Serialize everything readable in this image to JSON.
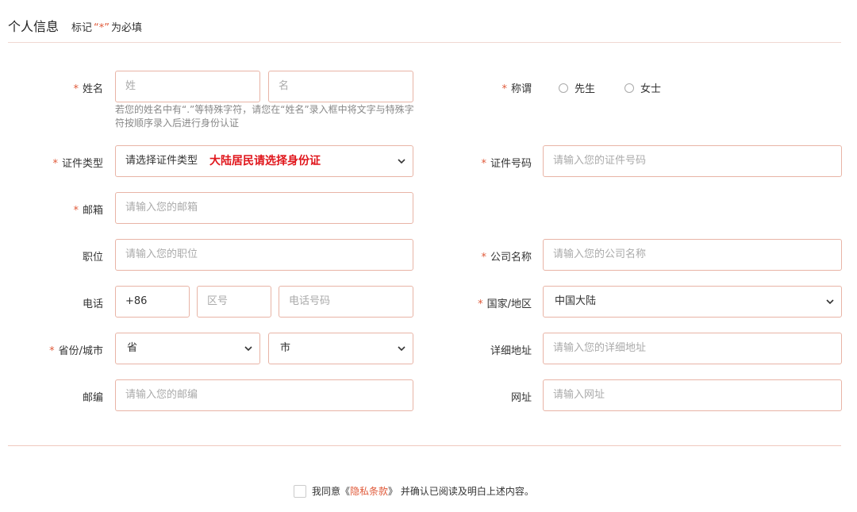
{
  "header": {
    "title": "个人信息",
    "hint_prefix": "标记",
    "hint_star": "“*”",
    "hint_suffix": "为必填"
  },
  "required_mark": "*",
  "name": {
    "label": "姓名",
    "surname_placeholder": "姓",
    "given_placeholder": "名",
    "note": "若您的姓名中有“.”等特殊字符，请您在“姓名”录入框中将文字与特殊字符按顺序录入后进行身份认证"
  },
  "salutation": {
    "label": "称谓",
    "options": [
      "先生",
      "女士"
    ]
  },
  "id_type": {
    "label": "证件类型",
    "value": "请选择证件类型",
    "warning": "大陆居民请选择身份证"
  },
  "id_number": {
    "label": "证件号码",
    "placeholder": "请输入您的证件号码"
  },
  "email": {
    "label": "邮箱",
    "placeholder": "请输入您的邮箱"
  },
  "position": {
    "label": "职位",
    "placeholder": "请输入您的职位"
  },
  "company": {
    "label": "公司名称",
    "placeholder": "请输入您的公司名称"
  },
  "phone": {
    "label": "电话",
    "country_code": "+86",
    "area_placeholder": "区号",
    "number_placeholder": "电话号码"
  },
  "country": {
    "label": "国家/地区",
    "value": "中国大陆"
  },
  "province_city": {
    "label": "省份/城市",
    "province": "省",
    "city": "市"
  },
  "address": {
    "label": "详细地址",
    "placeholder": "请输入您的详细地址"
  },
  "zip": {
    "label": "邮编",
    "placeholder": "请输入您的邮编"
  },
  "website": {
    "label": "网址",
    "placeholder": "请输入网址"
  },
  "agreement": {
    "prefix": "我同意《",
    "link": "隐私条款",
    "suffix": "》 并确认已阅读及明白上述内容。"
  },
  "colors": {
    "accent": "#e05a3a",
    "border": "#e8b4a6",
    "warning": "#e0151b"
  }
}
